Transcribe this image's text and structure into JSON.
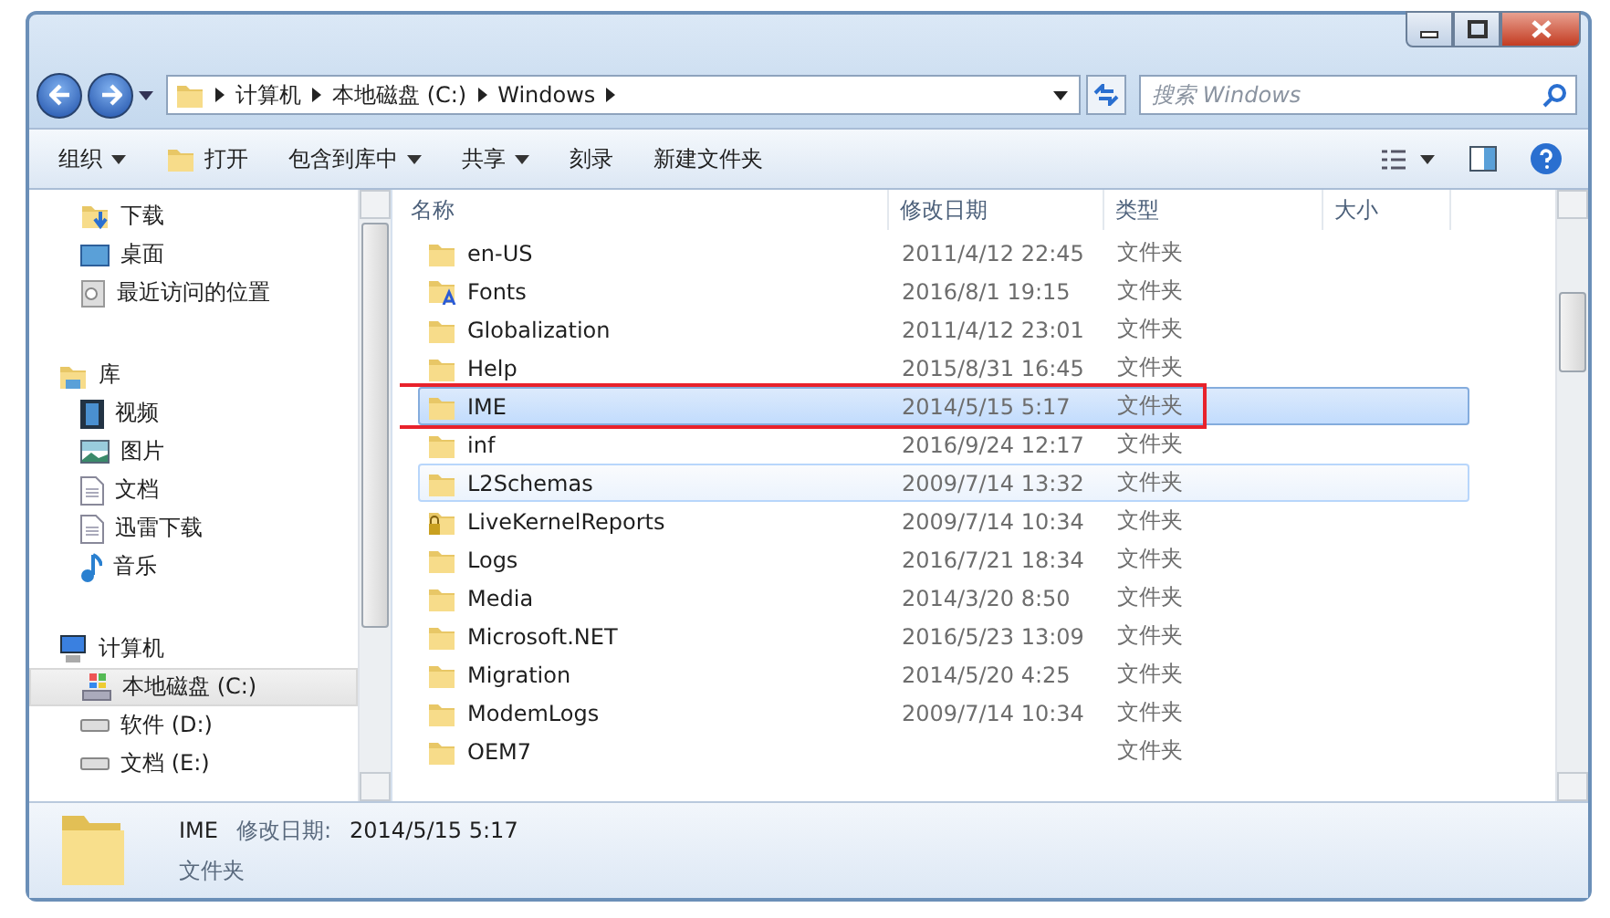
{
  "address_bar": {
    "segments": [
      "计算机",
      "本地磁盘 (C:)",
      "Windows"
    ]
  },
  "search": {
    "placeholder": "搜索 Windows"
  },
  "toolbar": {
    "buttons": [
      {
        "label": "组织",
        "dropdown": true,
        "kind": "plain"
      },
      {
        "label": "打开",
        "dropdown": false,
        "kind": "open"
      },
      {
        "label": "包含到库中",
        "dropdown": true,
        "kind": "plain"
      },
      {
        "label": "共享",
        "dropdown": true,
        "kind": "plain"
      },
      {
        "label": "刻录",
        "dropdown": false,
        "kind": "plain"
      },
      {
        "label": "新建文件夹",
        "dropdown": false,
        "kind": "plain"
      }
    ]
  },
  "sidebar": {
    "items": [
      {
        "label": "下载",
        "kind": "download",
        "selected": false
      },
      {
        "label": "桌面",
        "kind": "desktop",
        "selected": false
      },
      {
        "label": "最近访问的位置",
        "kind": "recent",
        "selected": false
      },
      {
        "label": "库",
        "kind": "library",
        "selected": false,
        "children": [
          {
            "label": "视频",
            "kind": "video",
            "selected": false
          },
          {
            "label": "图片",
            "kind": "picture",
            "selected": false
          },
          {
            "label": "文档",
            "kind": "document",
            "selected": false
          },
          {
            "label": "迅雷下载",
            "kind": "document",
            "selected": false
          },
          {
            "label": "音乐",
            "kind": "music",
            "selected": false
          }
        ]
      },
      {
        "label": "计算机",
        "kind": "computer",
        "selected": false,
        "children": [
          {
            "label": "本地磁盘 (C:)",
            "kind": "system",
            "selected": true
          },
          {
            "label": "软件 (D:)",
            "kind": "drive",
            "selected": false
          },
          {
            "label": "文档 (E:)",
            "kind": "drive",
            "selected": false
          }
        ]
      }
    ]
  },
  "table": {
    "columns": [
      "名称",
      "修改日期",
      "类型",
      "大小"
    ],
    "rows": [
      {
        "name": "en-US",
        "date": "2011/4/12 22:45",
        "type": "文件夹",
        "kind": "folder",
        "selected": false,
        "hovered": false,
        "annotated": false
      },
      {
        "name": "Fonts",
        "date": "2016/8/1 19:15",
        "type": "文件夹",
        "kind": "fonts",
        "selected": false,
        "hovered": false,
        "annotated": false
      },
      {
        "name": "Globalization",
        "date": "2011/4/12 23:01",
        "type": "文件夹",
        "kind": "folder",
        "selected": false,
        "hovered": false,
        "annotated": false
      },
      {
        "name": "Help",
        "date": "2015/8/31 16:45",
        "type": "文件夹",
        "kind": "folder",
        "selected": false,
        "hovered": false,
        "annotated": false
      },
      {
        "name": "IME",
        "date": "2014/5/15 5:17",
        "type": "文件夹",
        "kind": "folder",
        "selected": true,
        "hovered": false,
        "annotated": true
      },
      {
        "name": "inf",
        "date": "2016/9/24 12:17",
        "type": "文件夹",
        "kind": "folder",
        "selected": false,
        "hovered": false,
        "annotated": false
      },
      {
        "name": "L2Schemas",
        "date": "2009/7/14 13:32",
        "type": "文件夹",
        "kind": "folder",
        "selected": false,
        "hovered": true,
        "annotated": false
      },
      {
        "name": "LiveKernelReports",
        "date": "2009/7/14 10:34",
        "type": "文件夹",
        "kind": "locked",
        "selected": false,
        "hovered": false,
        "annotated": false
      },
      {
        "name": "Logs",
        "date": "2016/7/21 18:34",
        "type": "文件夹",
        "kind": "folder",
        "selected": false,
        "hovered": false,
        "annotated": false
      },
      {
        "name": "Media",
        "date": "2014/3/20 8:50",
        "type": "文件夹",
        "kind": "folder",
        "selected": false,
        "hovered": false,
        "annotated": false
      },
      {
        "name": "Microsoft.NET",
        "date": "2016/5/23 13:09",
        "type": "文件夹",
        "kind": "folder",
        "selected": false,
        "hovered": false,
        "annotated": false
      },
      {
        "name": "Migration",
        "date": "2014/5/20 4:25",
        "type": "文件夹",
        "kind": "folder",
        "selected": false,
        "hovered": false,
        "annotated": false
      },
      {
        "name": "ModemLogs",
        "date": "2009/7/14 10:34",
        "type": "文件夹",
        "kind": "folder",
        "selected": false,
        "hovered": false,
        "annotated": false
      },
      {
        "name": "OEM7",
        "type": "文件夹",
        "kind": "folder",
        "selected": false,
        "hovered": false,
        "annotated": false
      }
    ]
  },
  "details": {
    "name": "IME",
    "date_label": "修改日期:",
    "date": "2014/5/15 5:17",
    "type": "文件夹"
  }
}
